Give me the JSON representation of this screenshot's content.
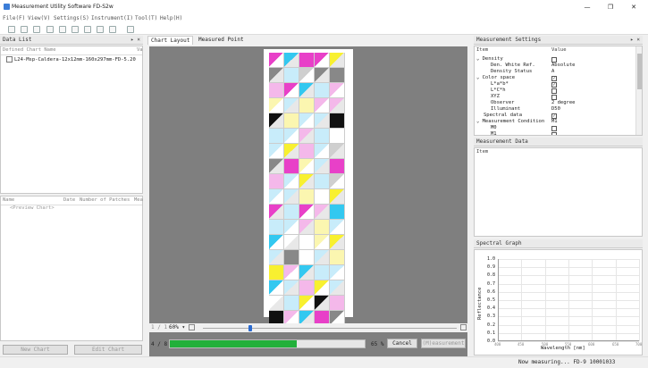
{
  "window": {
    "title": "Measurement Utility Software FD-S2w",
    "minimize": "—",
    "maximize": "❐",
    "close": "✕"
  },
  "menu": {
    "items": [
      "File(F)",
      "View(V)",
      "Settings(S)",
      "Instrument(I)",
      "Tool(T)",
      "Help(H)"
    ]
  },
  "data_list": {
    "title": "Data List",
    "col_header": "Defined Chart Name",
    "col_header2": "Va",
    "chart_item": "L24-Msp-Caldera-12x12mm-160x297mm-FD-5.20",
    "table_headers": [
      "Name",
      "Date",
      "Number of Patches",
      "Mea"
    ],
    "preview_label": "<Preview Chart>",
    "new_chart": "New Chart",
    "edit_chart": "Edit Chart"
  },
  "center": {
    "tabs": [
      "Chart Layout",
      "Measured Point"
    ],
    "page_indicator": "1 / 1",
    "zoom_value": "60%",
    "progress_count": "4 / 8",
    "progress_percent": "65 %",
    "progress_value": 0.65,
    "cancel": "Cancel",
    "measurement": "(M)easurement"
  },
  "settings": {
    "title": "Measurement Settings",
    "col_item": "Item",
    "col_value": "Value",
    "rows": [
      {
        "label": "Density",
        "value": "",
        "level": 0,
        "expand": "⌄",
        "check": true,
        "checked": false
      },
      {
        "label": "Den. White Ref.",
        "value": "Absolute",
        "level": 2,
        "expand": "",
        "check": false,
        "checked": false
      },
      {
        "label": "Density Status",
        "value": "A",
        "level": 2,
        "expand": "",
        "check": false,
        "checked": false
      },
      {
        "label": "Color space",
        "value": "",
        "level": 0,
        "expand": "⌄",
        "check": true,
        "checked": true
      },
      {
        "label": "L*a*b*",
        "value": "",
        "level": 2,
        "expand": "",
        "check": true,
        "checked": true
      },
      {
        "label": "L*C*h",
        "value": "",
        "level": 2,
        "expand": "",
        "check": true,
        "checked": false
      },
      {
        "label": "XYZ",
        "value": "",
        "level": 2,
        "expand": "",
        "check": true,
        "checked": false
      },
      {
        "label": "Observer",
        "value": "2 degree",
        "level": 2,
        "expand": "",
        "check": false,
        "checked": false
      },
      {
        "label": "Illuminant",
        "value": "D50",
        "level": 2,
        "expand": "",
        "check": false,
        "checked": false
      },
      {
        "label": "Spectral data",
        "value": "",
        "level": 1,
        "expand": "",
        "check": true,
        "checked": true
      },
      {
        "label": "Measurement Condition",
        "value": "M1",
        "level": 0,
        "expand": "⌄",
        "check": false,
        "checked": false
      },
      {
        "label": "M0",
        "value": "",
        "level": 2,
        "expand": "",
        "check": true,
        "checked": false
      },
      {
        "label": "M1",
        "value": "",
        "level": 2,
        "expand": "",
        "check": true,
        "checked": false
      }
    ]
  },
  "measurement_data": {
    "title": "Measurement Data",
    "col_item": "Item"
  },
  "spectral_graph": {
    "title": "Spectral Graph",
    "ylabel": "Reflectance",
    "xlabel": "Wavelength [nm]",
    "yticks": [
      "1.0",
      "0.9",
      "0.8",
      "0.7",
      "0.6",
      "0.5",
      "0.4",
      "0.3",
      "0.2",
      "0.1",
      "0.0"
    ],
    "xticks": [
      "400",
      "450",
      "500",
      "550",
      "600",
      "650",
      "700"
    ]
  },
  "status": {
    "text": "Now measuring... FD-9 10001033"
  },
  "chart_colors": {
    "w": "#ffffff",
    "c": "#33c8f0",
    "m": "#e840c8",
    "y": "#f8f030",
    "k": "#111111",
    "g": "#888888",
    "lg": "#cfcfcf",
    "lc": "#c8ecfa",
    "lm": "#f4b8ea",
    "ly": "#fbf6b0",
    "dc": "#1aa0d0",
    "dm": "#b82a98"
  },
  "chart_rows": [
    [
      "m",
      "c",
      "m",
      "m",
      "y"
    ],
    [
      "g",
      "lc",
      "lg",
      "g",
      "g"
    ],
    [
      "lm",
      "m",
      "c",
      "lc",
      "lm"
    ],
    [
      "ly",
      "lc",
      "ly",
      "lm",
      "lm"
    ],
    [
      "k",
      "ly",
      "lc",
      "lc",
      "k"
    ],
    [
      "lc",
      "lc",
      "lm",
      "lc",
      "w"
    ],
    [
      "lc",
      "y",
      "lm",
      "lc",
      "lg"
    ],
    [
      "g",
      "m",
      "ly",
      "lc",
      "m"
    ],
    [
      "lm",
      "lc",
      "y",
      "lc",
      "lg"
    ],
    [
      "lc",
      "lc",
      "ly",
      "w",
      "y"
    ],
    [
      "m",
      "lc",
      "m",
      "lm",
      "c"
    ],
    [
      "lc",
      "lc",
      "lm",
      "ly",
      "lc"
    ],
    [
      "c",
      "w",
      "w",
      "ly",
      "y"
    ],
    [
      "lc",
      "g",
      "w",
      "lc",
      "ly"
    ],
    [
      "y",
      "lm",
      "c",
      "lc",
      "lc"
    ],
    [
      "c",
      "lc",
      "lm",
      "y",
      "lc"
    ],
    [
      "w",
      "lc",
      "y",
      "k",
      "lm"
    ],
    [
      "k",
      "lm",
      "c",
      "m",
      "g"
    ]
  ]
}
